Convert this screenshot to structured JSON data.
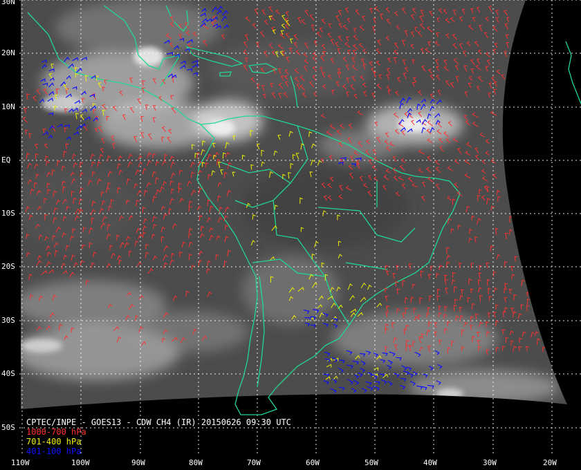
{
  "caption": {
    "title": "CPTEC/INPE - GOES13 - CDW CH4 (IR) 20150626 09:30 UTC",
    "legend": [
      {
        "label": "1000-700 hPa",
        "color": "#ff3030"
      },
      {
        "label": "701-400 hPa",
        "color": "#f0f000"
      },
      {
        "label": "401-100 hPa",
        "color": "#1010ff"
      }
    ]
  },
  "latitude_labels": [
    "30N",
    "20N",
    "10N",
    "EQ",
    "10S",
    "20S",
    "30S",
    "40S",
    "50S"
  ],
  "longitude_labels": [
    "110W",
    "100W",
    "90W",
    "80W",
    "70W",
    "60W",
    "50W",
    "40W",
    "30W",
    "20W"
  ],
  "colors": {
    "background": "#000000",
    "coastline": "#20d890",
    "graticule": "#ffffff",
    "low_level_vectors": "#ff3030",
    "mid_level_vectors": "#f0f000",
    "high_level_vectors": "#1010ff"
  }
}
